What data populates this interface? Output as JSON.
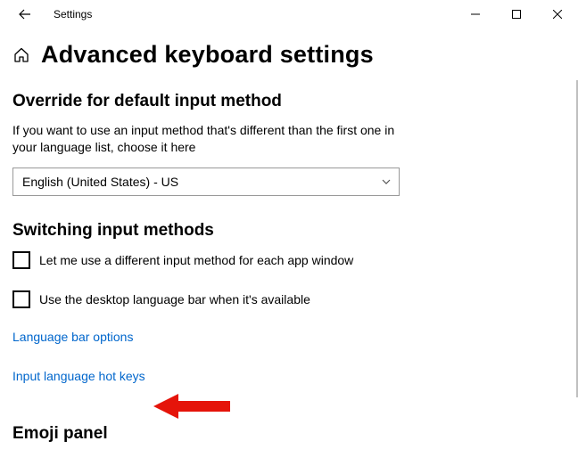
{
  "titlebar": {
    "app_name": "Settings"
  },
  "page": {
    "title": "Advanced keyboard settings"
  },
  "override": {
    "title": "Override for default input method",
    "description": "If you want to use an input method that's different than the first one in your language list, choose it here",
    "selected": "English (United States) - US"
  },
  "switching": {
    "title": "Switching input methods",
    "per_app_label": "Let me use a different input method for each app window",
    "desktop_langbar_label": "Use the desktop language bar when it's available",
    "link_langbar_options": "Language bar options",
    "link_hotkeys": "Input language hot keys"
  },
  "emoji": {
    "title": "Emoji panel"
  }
}
